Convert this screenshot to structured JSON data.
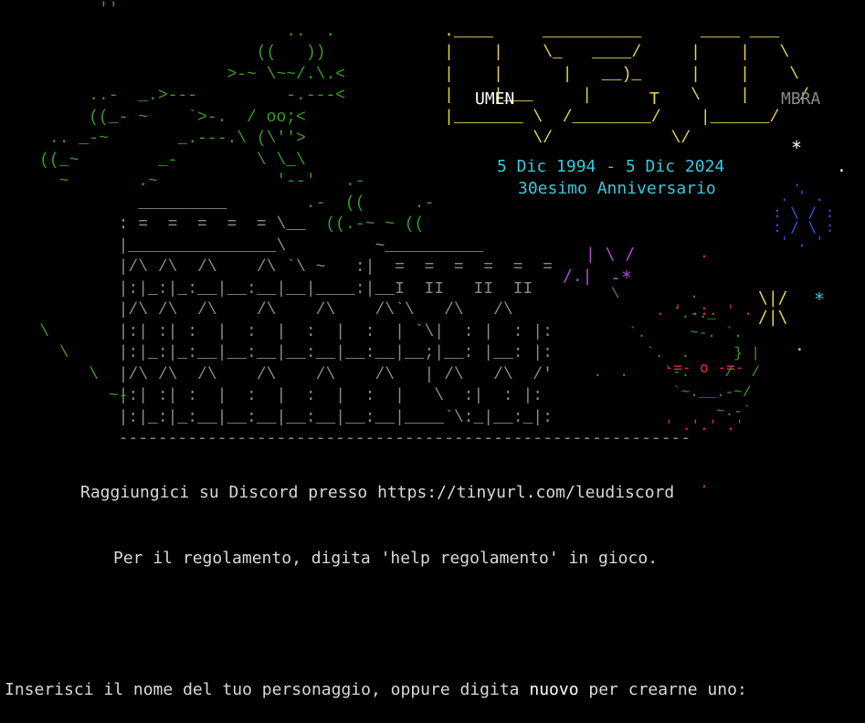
{
  "art": {
    "green": [
      "          ''",
      "                             ..  .",
      "                          ((   ))",
      "                       >-~ \\~~/.\\.<",
      "         ..-  _.>---         -.---<",
      "         ((_- ~    `>-.  / oo;<",
      "     .. _-~       _.---.\\ (\\''>",
      "    ((_~        _-        \\ \\_\\",
      "      ~       .~            '--'   .-",
      "                               .-  ((     .-",
      "                                 ((.-~ ~ ((",
      "",
      "",
      "",
      "",
      "    \\",
      "      \\",
      "         \\",
      "           ~-",
      "",
      "",
      ""
    ],
    "grey": [
      "",
      "",
      "",
      "",
      "",
      "",
      "",
      "",
      "",
      "              _________",
      "            : =  =  =  =  = \\__",
      "            |_______________\\         ~__________",
      "            |/\\ /\\  /\\    /\\ `\\ ~   :|  =  =  =  =  =  =",
      "            |:|_:|_:__|__:__|__|____:|__I  II   II  II",
      "            |/\\ /\\  /\\    /\\    /\\    /\\`\\   /\\   /\\",
      "            |:| :| :  |  :  |  :  |  :  | `\\|  : |  : |:",
      "            |:|_:|_:__|__:__|__:__|__:__|__;|__: |__: |:",
      "            |/\\ /\\  /\\    /\\    /\\    /\\   | /\\   /\\  /'",
      "            |:| :| :  |  :  |  :  |  :  |   \\  :|  : |:",
      "            |:|_:|_:__|__:__|__:__|__:__|____`\\:_|__:_|:",
      "            ----------------------------------------------------------"
    ],
    "logo": [
      "                                             .____     __________      ____ ___",
      "                                             |    |    \\_   ____/     |    |   \\",
      "                                             |    |      |   __)_     |    |    \\",
      "                                             |    |___     |          \\    |     /",
      "                                             |_______ \\  /________/    |______/",
      "                                                      \\/            \\/"
    ],
    "logo_words": {
      "umen": "UMEN",
      "t": "T",
      "mbra": "MBRA"
    },
    "dates": "5 Dic 1994 - 5 Dic 2024",
    "anniversary": "30esimo Anniversario",
    "firework": [
      ".",
      ". ' .:. ' .",
      "-=- o -=-",
      "' .'.' .'",
      "."
    ]
  },
  "messages": {
    "discord": "Raggiungici su Discord presso https://tinyurl.com/leudiscord",
    "rules": "Per il regolamento, digita 'help regolamento' in gioco.",
    "prompt_before": "Inserisci il nome del tuo personaggio, oppure digita ",
    "prompt_keyword": "nuovo",
    "prompt_after": " per crearne uno:"
  },
  "colors": {
    "background": "#000000",
    "green": "#3a9a20",
    "grey": "#8a8a8a",
    "yellow": "#e6d64a",
    "cyan": "#37c9dd",
    "red": "#e03030",
    "purple": "#b04ad0",
    "blue": "#3850e0"
  }
}
